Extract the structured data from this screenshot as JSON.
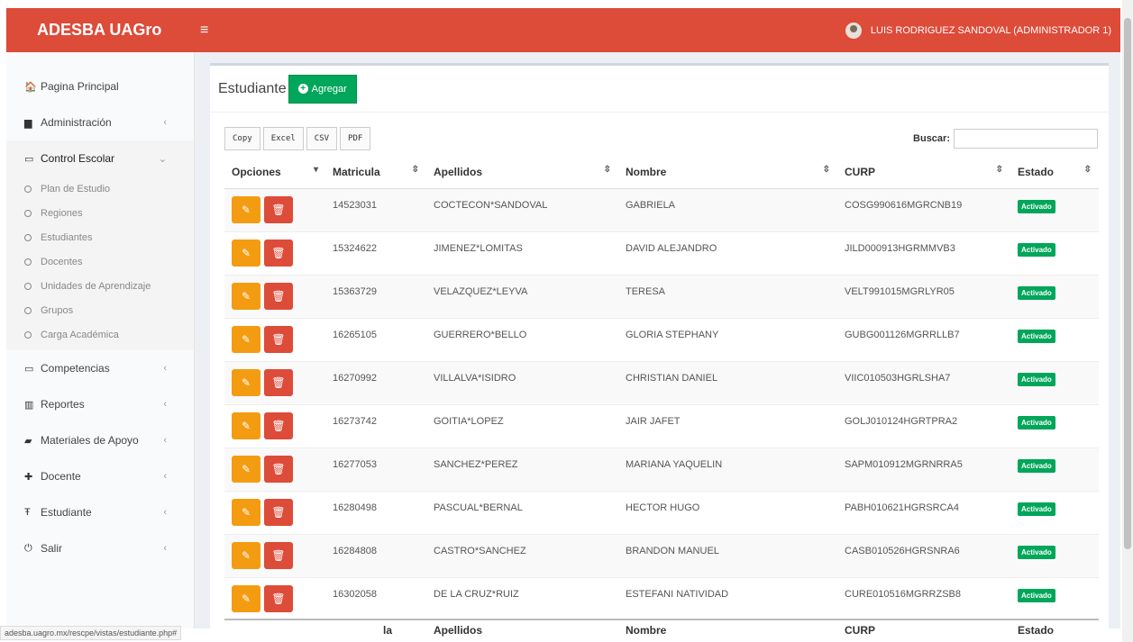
{
  "header": {
    "brand": "ADESBA UAGro",
    "menu_icon": "≡",
    "user": "LUIS RODRIGUEZ SANDOVAL (ADMINISTRADOR 1)"
  },
  "sidebar": {
    "items": [
      {
        "icon": "home-icon",
        "glyph": "🏠",
        "label": "Pagina Principal"
      },
      {
        "icon": "folder-icon",
        "glyph": "▆",
        "label": "Administración",
        "chev": "‹"
      },
      {
        "icon": "laptop-icon",
        "glyph": "▭",
        "label": "Control Escolar",
        "chev": "⌄"
      },
      {
        "icon": "laptop-icon",
        "glyph": "▭",
        "label": "Competencias",
        "chev": "‹"
      },
      {
        "icon": "chart-icon",
        "glyph": "▥",
        "label": "Reportes",
        "chev": "‹"
      },
      {
        "icon": "book-icon",
        "glyph": "▰",
        "label": "Materiales de Apoyo",
        "chev": "‹"
      },
      {
        "icon": "user-icon",
        "glyph": "✚",
        "label": "Docente",
        "chev": "‹"
      },
      {
        "icon": "graduate-icon",
        "glyph": "Ŧ",
        "label": "Estudiante",
        "chev": "‹"
      },
      {
        "icon": "power-icon",
        "glyph": "⏻",
        "label": "Salir",
        "chev": "‹"
      }
    ],
    "control_escolar_sub": [
      "Plan de Estudio",
      "Regiones",
      "Estudiantes",
      "Docentes",
      "Unidades de Aprendizaje",
      "Grupos",
      "Carga Académica"
    ]
  },
  "box": {
    "title": "Estudiante",
    "add_button": "Agregar"
  },
  "tools": {
    "copy": "Copy",
    "excel": "Excel",
    "csv": "CSV",
    "pdf": "PDF",
    "search_label": "Buscar:",
    "search_value": ""
  },
  "table": {
    "columns": [
      "Opciones",
      "Matricula",
      "Apellidos",
      "Nombre",
      "CURP",
      "Estado"
    ],
    "rows": [
      {
        "matricula": "14523031",
        "apellidos": "COCTECON*SANDOVAL",
        "nombre": "GABRIELA",
        "curp": "COSG990616MGRCNB19",
        "estado": "Activado"
      },
      {
        "matricula": "15324622",
        "apellidos": "JIMENEZ*LOMITAS",
        "nombre": "DAVID ALEJANDRO",
        "curp": "JILD000913HGRMMVB3",
        "estado": "Activado"
      },
      {
        "matricula": "15363729",
        "apellidos": "VELAZQUEZ*LEYVA",
        "nombre": "TERESA",
        "curp": "VELT991015MGRLYR05",
        "estado": "Activado"
      },
      {
        "matricula": "16265105",
        "apellidos": "GUERRERO*BELLO",
        "nombre": "GLORIA STEPHANY",
        "curp": "GUBG001126MGRRLLB7",
        "estado": "Activado"
      },
      {
        "matricula": "16270992",
        "apellidos": "VILLALVA*ISIDRO",
        "nombre": "CHRISTIAN DANIEL",
        "curp": "VIIC010503HGRLSHA7",
        "estado": "Activado"
      },
      {
        "matricula": "16273742",
        "apellidos": "GOITIA*LOPEZ",
        "nombre": "JAIR JAFET",
        "curp": "GOLJ010124HGRTPRA2",
        "estado": "Activado"
      },
      {
        "matricula": "16277053",
        "apellidos": "SANCHEZ*PEREZ",
        "nombre": "MARIANA YAQUELIN",
        "curp": "SAPM010912MGRNRRA5",
        "estado": "Activado"
      },
      {
        "matricula": "16280498",
        "apellidos": "PASCUAL*BERNAL",
        "nombre": "HECTOR HUGO",
        "curp": "PABH010621HGRSRCA4",
        "estado": "Activado"
      },
      {
        "matricula": "16284808",
        "apellidos": "CASTRO*SANCHEZ",
        "nombre": "BRANDON MANUEL",
        "curp": "CASB010526HGRSNRA6",
        "estado": "Activado"
      },
      {
        "matricula": "16302058",
        "apellidos": "DE LA CRUZ*RUIZ",
        "nombre": "ESTEFANI NATIVIDAD",
        "curp": "CURE010516MGRRZSB8",
        "estado": "Activado"
      }
    ],
    "footer": {
      "matricula": "la",
      "apellidos": "Apellidos",
      "nombre": "Nombre",
      "curp": "CURP",
      "estado": "Estado"
    }
  },
  "statusbar": "adesba.uagro.mx/rescpe/vistas/estudiante.php#"
}
